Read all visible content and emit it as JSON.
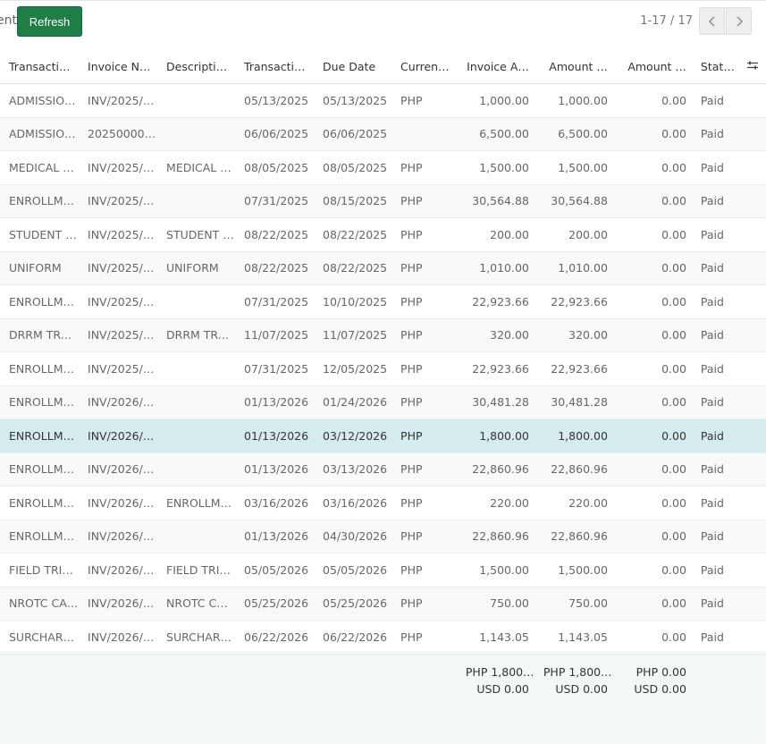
{
  "toolbar": {
    "partial_label": "ent",
    "refresh_label": "Refresh",
    "pager_text": "1-17 / 17",
    "prev_icon": "chevron-left-icon",
    "next_icon": "chevron-right-icon"
  },
  "table": {
    "columns": [
      "Transacti…",
      "Invoice N…",
      "Descripti…",
      "Transacti…",
      "Due Date",
      "Curren…",
      "Invoice A…",
      "Amount …",
      "Amount …",
      "Stat…"
    ],
    "settings_icon": "column-settings-icon",
    "rows": [
      [
        "ADMISSIO…",
        "INV/2025/0…",
        "",
        "05/13/2025",
        "05/13/2025",
        "PHP",
        "1,000.00",
        "1,000.00",
        "0.00",
        "Paid"
      ],
      [
        "ADMISSIO…",
        "202500004…",
        "",
        "06/06/2025",
        "06/06/2025",
        "",
        "6,500.00",
        "6,500.00",
        "0.00",
        "Paid"
      ],
      [
        "MEDICAL E…",
        "INV/2025/0…",
        "MEDICAL E…",
        "08/05/2025",
        "08/05/2025",
        "PHP",
        "1,500.00",
        "1,500.00",
        "0.00",
        "Paid"
      ],
      [
        "ENROLLME…",
        "INV/2025/0…",
        "",
        "07/31/2025",
        "08/15/2025",
        "PHP",
        "30,564.88",
        "30,564.88",
        "0.00",
        "Paid"
      ],
      [
        "STUDENT A…",
        "INV/2025/0…",
        "STUDENT A…",
        "08/22/2025",
        "08/22/2025",
        "PHP",
        "200.00",
        "200.00",
        "0.00",
        "Paid"
      ],
      [
        "UNIFORM",
        "INV/2025/0…",
        "UNIFORM",
        "08/22/2025",
        "08/22/2025",
        "PHP",
        "1,010.00",
        "1,010.00",
        "0.00",
        "Paid"
      ],
      [
        "ENROLLME…",
        "INV/2025/0…",
        "",
        "07/31/2025",
        "10/10/2025",
        "PHP",
        "22,923.66",
        "22,923.66",
        "0.00",
        "Paid"
      ],
      [
        "DRRM TRAI…",
        "INV/2025/1…",
        "DRRM TRAI…",
        "11/07/2025",
        "11/07/2025",
        "PHP",
        "320.00",
        "320.00",
        "0.00",
        "Paid"
      ],
      [
        "ENROLLME…",
        "INV/2025/0…",
        "",
        "07/31/2025",
        "12/05/2025",
        "PHP",
        "22,923.66",
        "22,923.66",
        "0.00",
        "Paid"
      ],
      [
        "ENROLLME…",
        "INV/2026/0…",
        "",
        "01/13/2026",
        "01/24/2026",
        "PHP",
        "30,481.28",
        "30,481.28",
        "0.00",
        "Paid"
      ],
      [
        "ENROLLME…",
        "INV/2026/0…",
        "",
        "01/13/2026",
        "03/12/2026",
        "PHP",
        "1,800.00",
        "1,800.00",
        "0.00",
        "Paid"
      ],
      [
        "ENROLLME…",
        "INV/2026/0…",
        "",
        "01/13/2026",
        "03/13/2026",
        "PHP",
        "22,860.96",
        "22,860.96",
        "0.00",
        "Paid"
      ],
      [
        "ENROLLME…",
        "INV/2026/0…",
        "ENROLLME…",
        "03/16/2026",
        "03/16/2026",
        "PHP",
        "220.00",
        "220.00",
        "0.00",
        "Paid"
      ],
      [
        "ENROLLME…",
        "INV/2026/0…",
        "",
        "01/13/2026",
        "04/30/2026",
        "PHP",
        "22,860.96",
        "22,860.96",
        "0.00",
        "Paid"
      ],
      [
        "FIELD TRIP-…",
        "INV/2026/0…",
        "FIELD TRIP-…",
        "05/05/2026",
        "05/05/2026",
        "PHP",
        "1,500.00",
        "1,500.00",
        "0.00",
        "Paid"
      ],
      [
        "NROTC CA…",
        "INV/2026/0…",
        "NROTC CA…",
        "05/25/2026",
        "05/25/2026",
        "PHP",
        "750.00",
        "750.00",
        "0.00",
        "Paid"
      ],
      [
        "SURCHARGE",
        "INV/2026/0…",
        "SURCHARGE",
        "06/22/2026",
        "06/22/2026",
        "PHP",
        "1,143.05",
        "1,143.05",
        "0.00",
        "Paid"
      ]
    ],
    "selected_row_index": 10,
    "totals": {
      "invoice_amount": [
        "PHP 1,800.…",
        "USD 0.00"
      ],
      "amount_paid": [
        "PHP 1,800.…",
        "USD 0.00"
      ],
      "amount_due": [
        "PHP 0.00",
        "USD 0.00"
      ]
    }
  },
  "colors": {
    "accent": "#1e7e45",
    "selected_row": "#d5ecee",
    "footer_bg": "#f4f7f8"
  }
}
